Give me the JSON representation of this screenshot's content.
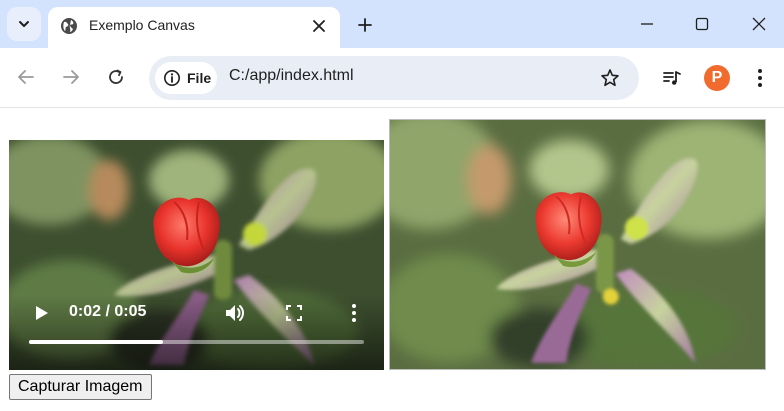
{
  "browser": {
    "tab": {
      "title": "Exemplo Canvas"
    },
    "omnibox": {
      "chip_label": "File",
      "url": "C:/app/index.html"
    },
    "profile_initial": "P",
    "colors": {
      "tabstrip": "#d3e3fd",
      "omnibox": "#e9eef6",
      "avatar": "#f26b2e"
    },
    "icons": [
      "tab-search-icon",
      "globe-icon",
      "close-icon",
      "plus-icon",
      "minimize-icon",
      "maximize-icon",
      "window-close-icon",
      "back-arrow-icon",
      "forward-arrow-icon",
      "reload-icon",
      "info-icon",
      "star-icon",
      "media-playlist-icon",
      "kebab-menu-icon"
    ]
  },
  "page": {
    "video": {
      "time_display": "0:02 / 0:05",
      "progress": 0.4
    },
    "capture_button": {
      "label": "Capturar Imagem"
    }
  }
}
